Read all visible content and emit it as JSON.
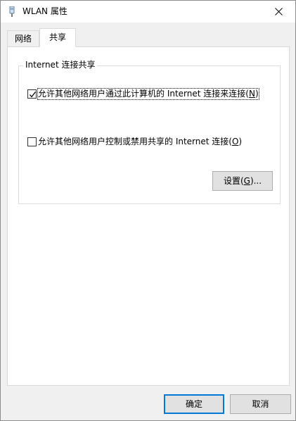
{
  "window": {
    "title": "WLAN 属性",
    "icon": "network-adapter-icon",
    "close_icon": "close-icon"
  },
  "tabs": [
    {
      "label": "网络",
      "active": false
    },
    {
      "label": "共享",
      "active": true
    }
  ],
  "group": {
    "legend": "Internet 连接共享",
    "option1": {
      "text": "允许其他网络用户通过此计算机的 Internet 连接来连接(",
      "key": "N",
      "suffix": ")",
      "checked": true
    },
    "option2": {
      "text": "允许其他网络用户控制或禁用共享的 Internet 连接(",
      "key": "O",
      "suffix": ")",
      "checked": false
    },
    "settings_button": {
      "text": "设置(",
      "key": "G",
      "suffix": ")..."
    }
  },
  "footer": {
    "ok_label": "确定",
    "cancel_label": "取消"
  },
  "colors": {
    "focus_border": "#0078d7",
    "background": "#f0f0f0",
    "panel": "#ffffff"
  }
}
